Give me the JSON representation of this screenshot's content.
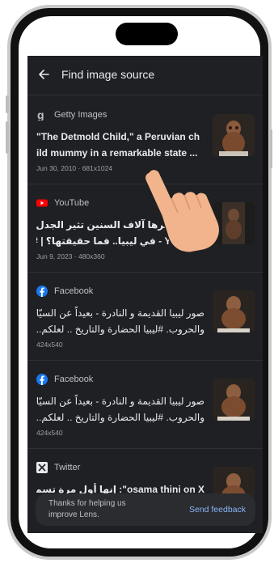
{
  "header": {
    "title": "Find image source"
  },
  "results": [
    {
      "source": "Getty Images",
      "source_icon": "getty-icon",
      "title_lines": [
        "\"The Detmold Child,\" a Peruvian ch",
        "ild mummy in a remarkable state ..."
      ],
      "meta": "Jun 30, 2010 · 681x1024"
    },
    {
      "source": "YouTube",
      "source_icon": "youtube-icon",
      "title_lines": [
        "طفل عمرها آلاف السنين تثير الجدل فـ",
        "YouTube - في ليبيا.. فما حقيقتها؟ | #شير"
      ],
      "meta": "Jun 9, 2023 · 480x360"
    },
    {
      "source": "Facebook",
      "source_icon": "facebook-icon",
      "title_lines": [
        "صور ليبيا القديمة و النادرة - بعيداً عن السيّاس",
        "والحروب. #ليبيا الحضارة والتاريخ .. لعلكم.."
      ],
      "meta": "424x540"
    },
    {
      "source": "Facebook",
      "source_icon": "facebook-icon",
      "title_lines": [
        "صور ليبيا القديمة و النادرة - بعيداً عن السيّاس",
        "والحروب. #ليبيا الحضارة والتاريخ .. لعلكم.."
      ],
      "meta": "424x540"
    },
    {
      "source": "Twitter",
      "source_icon": "x-icon",
      "title_lines": [
        "osama thini on X\": إنها أول مرة تسمعو",
        ""
      ],
      "meta": ""
    }
  ],
  "toast": {
    "text_line1": "Thanks for helping us",
    "text_line2": "improve Lens.",
    "action": "Send feedback"
  },
  "colors": {
    "app_background": "#1f2023",
    "link": "#8ab4f8",
    "youtube": "#ff0000",
    "facebook": "#1877f2"
  }
}
